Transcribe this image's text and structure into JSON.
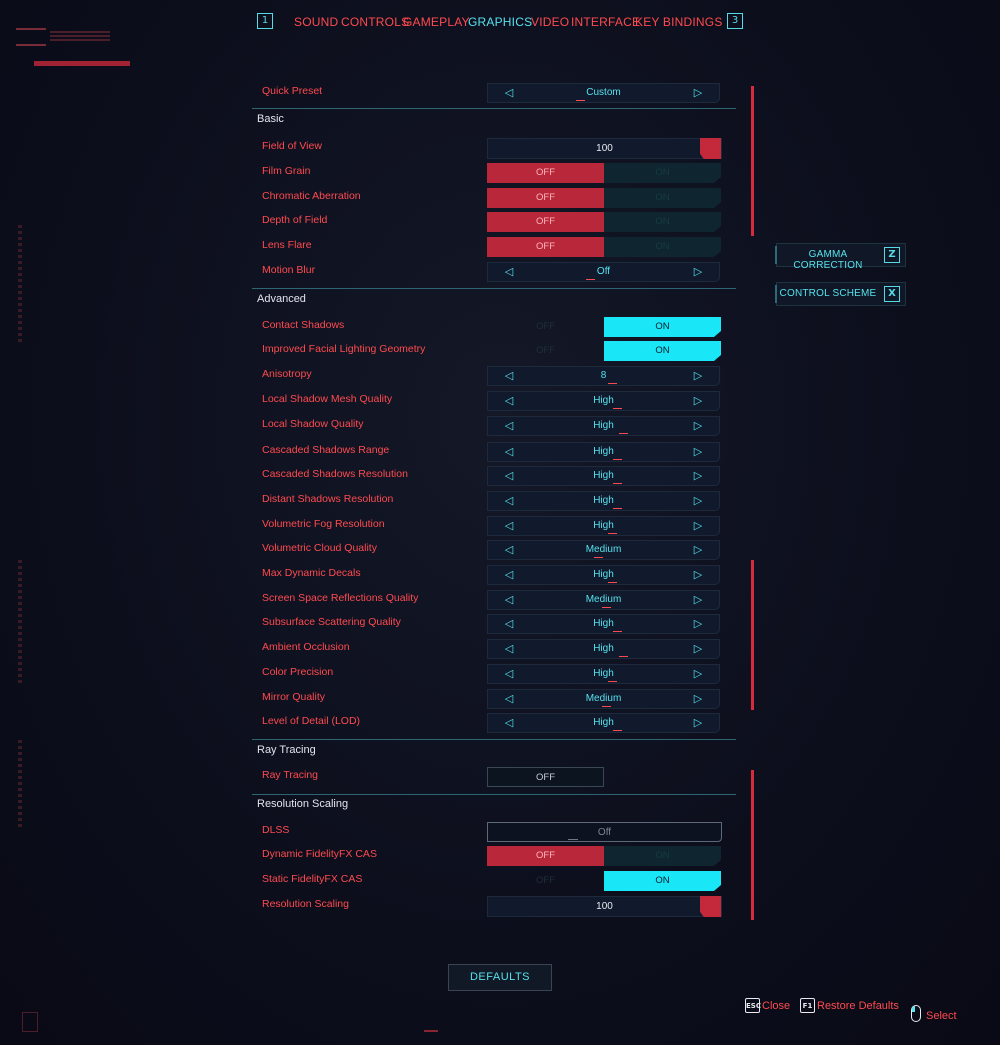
{
  "nav": {
    "left_key": "1",
    "right_key": "3",
    "tabs": [
      {
        "label": "SOUND",
        "active": false
      },
      {
        "label": "CONTROLS",
        "active": false
      },
      {
        "label": "GAMEPLAY",
        "active": false
      },
      {
        "label": "GRAPHICS",
        "active": true
      },
      {
        "label": "VIDEO",
        "active": false
      },
      {
        "label": "INTERFACE",
        "active": false
      },
      {
        "label": "KEY BINDINGS",
        "active": false
      }
    ]
  },
  "quick_preset": {
    "label": "Quick Preset",
    "value": "Custom"
  },
  "basic": {
    "title": "Basic",
    "fov": {
      "label": "Field of View",
      "value": "100"
    },
    "film_grain": {
      "label": "Film Grain",
      "off": "OFF",
      "on": "ON"
    },
    "chromatic": {
      "label": "Chromatic Aberration",
      "off": "OFF",
      "on": "ON"
    },
    "dof": {
      "label": "Depth of Field",
      "off": "OFF",
      "on": "ON"
    },
    "lens_flare": {
      "label": "Lens Flare",
      "off": "OFF",
      "on": "ON"
    },
    "motion_blur": {
      "label": "Motion Blur",
      "value": "Off"
    }
  },
  "advanced": {
    "title": "Advanced",
    "contact_shadows": {
      "label": "Contact Shadows",
      "off": "OFF",
      "on": "ON"
    },
    "facial_lighting": {
      "label": "Improved Facial Lighting Geometry",
      "off": "OFF",
      "on": "ON"
    },
    "anisotropy": {
      "label": "Anisotropy",
      "value": "8"
    },
    "local_shadow_mesh": {
      "label": "Local Shadow Mesh Quality",
      "value": "High"
    },
    "local_shadow_quality": {
      "label": "Local Shadow Quality",
      "value": "High"
    },
    "cascaded_range": {
      "label": "Cascaded Shadows Range",
      "value": "High"
    },
    "cascaded_res": {
      "label": "Cascaded Shadows Resolution",
      "value": "High"
    },
    "distant_shadows": {
      "label": "Distant Shadows Resolution",
      "value": "High"
    },
    "vol_fog": {
      "label": "Volumetric Fog Resolution",
      "value": "High"
    },
    "vol_cloud": {
      "label": "Volumetric Cloud Quality",
      "value": "Medium"
    },
    "decals": {
      "label": "Max Dynamic Decals",
      "value": "High"
    },
    "ssr": {
      "label": "Screen Space Reflections Quality",
      "value": "Medium"
    },
    "subsurface": {
      "label": "Subsurface Scattering Quality",
      "value": "High"
    },
    "ao": {
      "label": "Ambient Occlusion",
      "value": "High"
    },
    "color_precision": {
      "label": "Color Precision",
      "value": "High"
    },
    "mirror": {
      "label": "Mirror Quality",
      "value": "Medium"
    },
    "lod": {
      "label": "Level of Detail (LOD)",
      "value": "High"
    }
  },
  "ray_tracing": {
    "title": "Ray Tracing",
    "rt": {
      "label": "Ray Tracing",
      "value": "OFF"
    }
  },
  "res_scaling": {
    "title": "Resolution Scaling",
    "dlss": {
      "label": "DLSS",
      "value": "Off"
    },
    "dyn_cas": {
      "label": "Dynamic FidelityFX CAS",
      "off": "OFF",
      "on": "ON"
    },
    "static_cas": {
      "label": "Static FidelityFX CAS",
      "off": "OFF",
      "on": "ON"
    },
    "scaling": {
      "label": "Resolution Scaling",
      "value": "100"
    }
  },
  "side": {
    "gamma": {
      "label": "GAMMA CORRECTION",
      "key": "Z"
    },
    "control": {
      "label": "CONTROL SCHEME",
      "key": "X"
    }
  },
  "defaults_label": "DEFAULTS",
  "footer": {
    "close_key": "ESC",
    "close": "Close",
    "restore_key": "F1",
    "restore": "Restore Defaults",
    "select": "Select"
  },
  "colors": {
    "accent_red": "#ff4a4f",
    "accent_cyan": "#56e2ee",
    "toggle_on": "#19e6f7",
    "toggle_off": "#b9273a"
  }
}
